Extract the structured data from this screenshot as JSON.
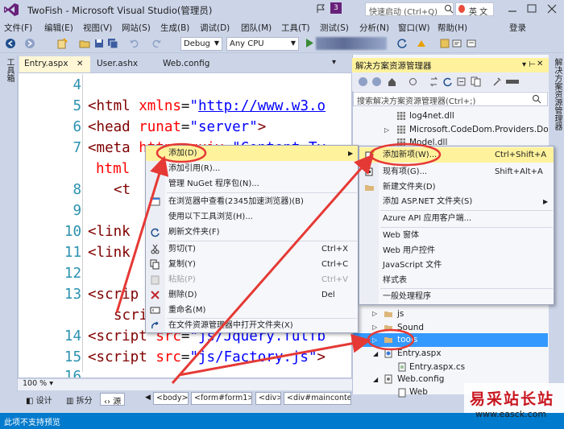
{
  "window": {
    "title": "TwoFish - Microsoft Visual Studio(管理员)",
    "notification_count": "3",
    "quick_launch_placeholder": "快速启动 (Ctrl+Q)",
    "ime_label": "英 文"
  },
  "menu": {
    "items": [
      "文件(F)",
      "编辑(E)",
      "视图(V)",
      "网站(S)",
      "生成(B)",
      "调试(D)",
      "团队(M)",
      "工具(T)",
      "测试(S)",
      "分析(N)",
      "窗口(W)",
      "帮助(H)"
    ],
    "login": "登录"
  },
  "toolbar": {
    "config": "Debug",
    "platform": "Any CPU"
  },
  "toolbox": {
    "label": "工具箱"
  },
  "tabs": [
    {
      "label": "Entry.aspx",
      "active": true
    },
    {
      "label": "User.ashx",
      "active": false
    },
    {
      "label": "Web.config",
      "active": false
    }
  ],
  "editor": {
    "line_numbers": [
      "4",
      "5",
      "6",
      "7",
      "",
      "8",
      "9",
      "10",
      "11",
      "12",
      "13",
      "",
      "14",
      "15",
      "16"
    ],
    "zoom": "100 %"
  },
  "view_tabs": [
    "设计",
    "拆分",
    "源"
  ],
  "breadcrumbs": [
    "<body>",
    "<form#form1>",
    "<div>",
    "<div#mainconter"
  ],
  "solution_explorer": {
    "title": "解决方案资源管理器",
    "search_placeholder": "搜索解决方案资源管理器(Ctrl+;)",
    "items": [
      {
        "label": "log4net.dll"
      },
      {
        "label": "Microsoft.CodeDom.Providers.Do"
      },
      {
        "label": "Model.dll"
      },
      {
        "label": "js"
      },
      {
        "label": "Sound"
      },
      {
        "label": "tools",
        "selected": true
      },
      {
        "label": "Entry.aspx"
      },
      {
        "label": "Entry.aspx.cs"
      },
      {
        "label": "Web.config"
      },
      {
        "label": "Web"
      }
    ]
  },
  "right_strip": {
    "label": "解决方案资源管理器"
  },
  "context_menu": {
    "items": [
      {
        "label": "添加(D)",
        "shortcut": "",
        "submenu": true,
        "highlighted": true
      },
      {
        "label": "添加引用(R)...",
        "shortcut": ""
      },
      {
        "label": "管理 NuGet 程序包(N)...",
        "shortcut": ""
      },
      {
        "label": "在浏览器中查看(2345加速浏览器)(B)",
        "shortcut": ""
      },
      {
        "label": "使用以下工具浏览(H)...",
        "shortcut": ""
      },
      {
        "label": "刷新文件夹(F)",
        "shortcut": ""
      },
      {
        "label": "剪切(T)",
        "shortcut": "Ctrl+X"
      },
      {
        "label": "复制(Y)",
        "shortcut": "Ctrl+C"
      },
      {
        "label": "粘贴(P)",
        "shortcut": "Ctrl+V",
        "disabled": true
      },
      {
        "label": "删除(D)",
        "shortcut": "Del"
      },
      {
        "label": "重命名(M)",
        "shortcut": ""
      },
      {
        "label": "在文件资源管理器中打开文件夹(X)",
        "shortcut": ""
      }
    ]
  },
  "submenu": {
    "items": [
      {
        "label": "添加新项(W)...",
        "shortcut": "Ctrl+Shift+A",
        "highlighted": true
      },
      {
        "label": "现有项(G)...",
        "shortcut": "Shift+Alt+A"
      },
      {
        "label": "新建文件夹(D)",
        "shortcut": ""
      },
      {
        "label": "添加 ASP.NET 文件夹(S)",
        "shortcut": "",
        "submenu": true
      },
      {
        "label": "Azure API 应用客户端...",
        "shortcut": ""
      },
      {
        "label": "Web 窗体",
        "shortcut": ""
      },
      {
        "label": "Web 用户控件",
        "shortcut": ""
      },
      {
        "label": "JavaScript 文件",
        "shortcut": ""
      },
      {
        "label": "样式表",
        "shortcut": ""
      },
      {
        "label": "一般处理程序",
        "shortcut": ""
      }
    ]
  },
  "status": {
    "text": "此项不支持预览"
  },
  "watermark": {
    "title": "易采站长站",
    "url": "www.easck.com"
  },
  "colors": {
    "accent": "#007acc",
    "highlight": "#fff29d",
    "selection": "#3399ff",
    "arrow": "#e53935",
    "brand": "#68217a"
  }
}
